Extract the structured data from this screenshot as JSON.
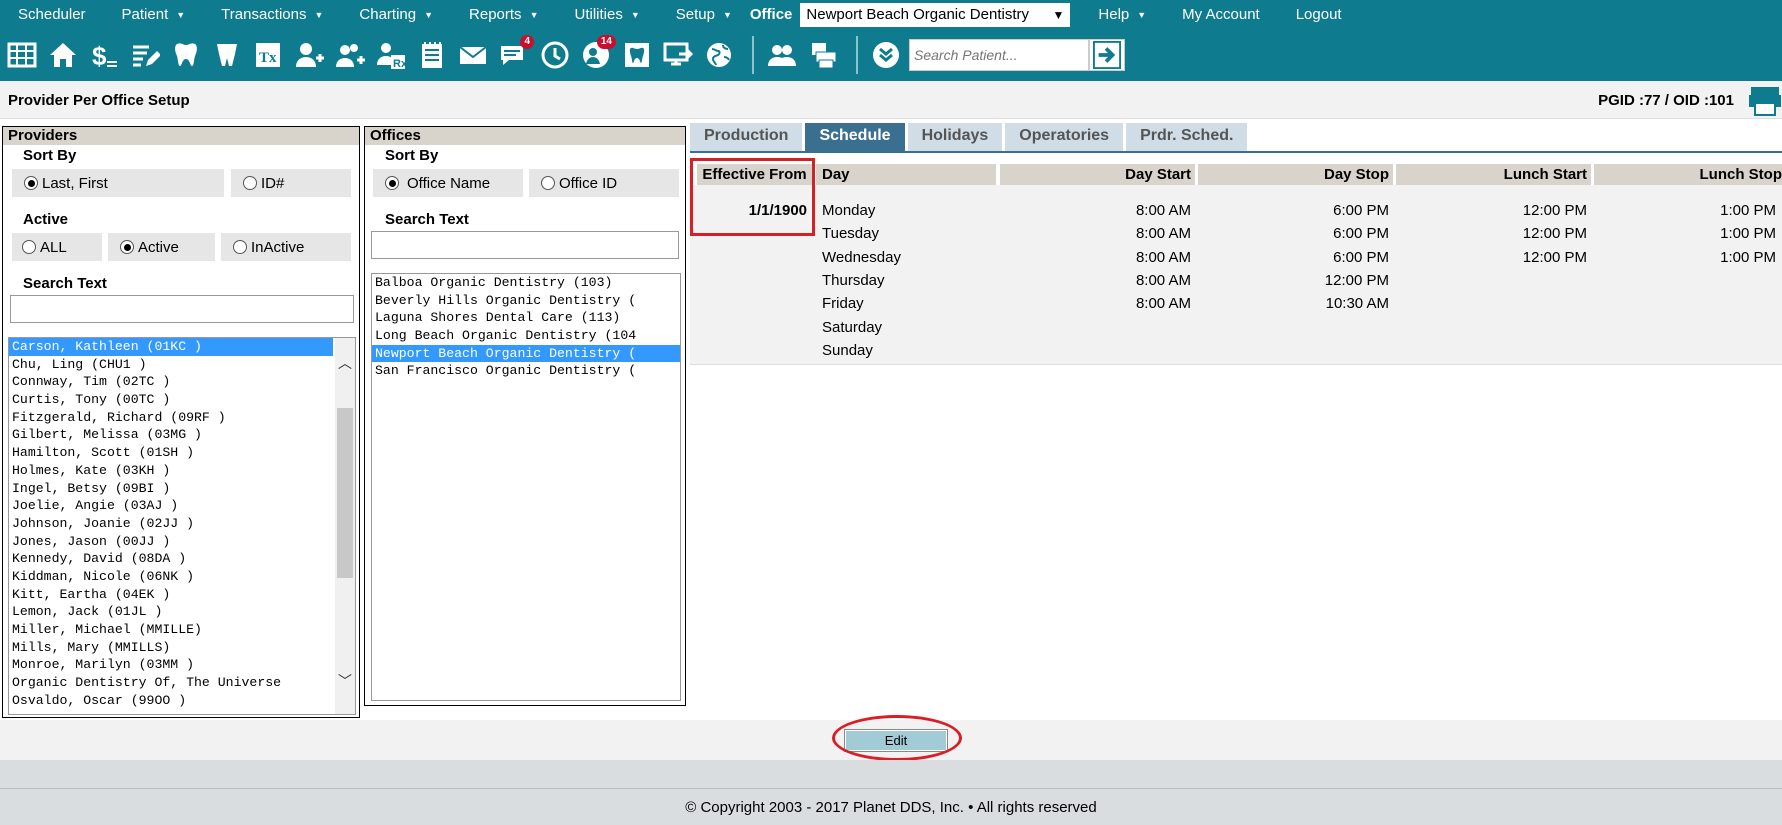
{
  "nav": {
    "items": [
      {
        "label": "Scheduler",
        "caret": false
      },
      {
        "label": "Patient",
        "caret": true
      },
      {
        "label": "Transactions",
        "caret": true
      },
      {
        "label": "Charting",
        "caret": true
      },
      {
        "label": "Reports",
        "caret": true
      },
      {
        "label": "Utilities",
        "caret": true
      },
      {
        "label": "Setup",
        "caret": true
      }
    ],
    "office_label": "Office",
    "office_value": "Newport Beach Organic Dentistry",
    "right_items": [
      {
        "label": "Help",
        "caret": true
      },
      {
        "label": "My Account",
        "caret": false
      },
      {
        "label": "Logout",
        "caret": false
      }
    ]
  },
  "toolbar": {
    "badge_messages": "4",
    "badge_users": "14",
    "search_placeholder": "Search Patient..."
  },
  "header": {
    "title": "Provider Per Office Setup",
    "pgid": "PGID :77  /  OID :101"
  },
  "providers": {
    "heading": "Providers",
    "sort_by_label": "Sort By",
    "sort_options": [
      "Last, First",
      "ID#"
    ],
    "active_label": "Active",
    "active_options": [
      "ALL",
      "Active",
      "InActive"
    ],
    "search_label": "Search Text",
    "list": [
      "Carson, Kathleen (01KC )",
      "Chu, Ling (CHU1 )",
      "Connway, Tim (02TC )",
      "Curtis, Tony (00TC )",
      "Fitzgerald, Richard (09RF )",
      "Gilbert, Melissa (03MG )",
      "Hamilton, Scott (01SH )",
      "Holmes, Kate (03KH )",
      "Ingel, Betsy (09BI )",
      "Joelie, Angie (03AJ )",
      "Johnson, Joanie (02JJ )",
      "Jones, Jason (00JJ )",
      "Kennedy, David (08DA )",
      "Kiddman, Nicole (06NK )",
      "Kitt, Eartha (04EK )",
      "Lemon, Jack (01JL )",
      "Miller, Michael (MMILLE)",
      "Mills, Mary (MMILLS)",
      "Monroe, Marilyn (03MM )",
      "Organic Dentistry Of, The Universe",
      "Osvaldo, Oscar (99OO )"
    ]
  },
  "offices": {
    "heading": "Offices",
    "sort_by_label": "Sort By",
    "sort_options": [
      "Office Name",
      "Office ID"
    ],
    "search_label": "Search Text",
    "list": [
      "Balboa Organic Dentistry (103)",
      "Beverly Hills Organic Dentistry (",
      "Laguna Shores Dental Care (113)",
      "Long Beach Organic Dentistry (104",
      "Newport Beach Organic Dentistry (",
      "San Francisco Organic Dentistry ("
    ]
  },
  "tabs": [
    "Production",
    "Schedule",
    "Holidays",
    "Operatories",
    "Prdr. Sched."
  ],
  "schedule": {
    "columns": [
      "Effective From",
      "Day",
      "Day Start",
      "Day Stop",
      "Lunch Start",
      "Lunch Stop"
    ],
    "effective_from": "1/1/1900",
    "rows": [
      {
        "day": "Monday",
        "start": "8:00 AM",
        "stop": "6:00 PM",
        "lunch_start": "12:00 PM",
        "lunch_stop": "1:00 PM"
      },
      {
        "day": "Tuesday",
        "start": "8:00 AM",
        "stop": "6:00 PM",
        "lunch_start": "12:00 PM",
        "lunch_stop": "1:00 PM"
      },
      {
        "day": "Wednesday",
        "start": "8:00 AM",
        "stop": "6:00 PM",
        "lunch_start": "12:00 PM",
        "lunch_stop": "1:00 PM"
      },
      {
        "day": "Thursday",
        "start": "8:00 AM",
        "stop": "12:00 PM",
        "lunch_start": "",
        "lunch_stop": ""
      },
      {
        "day": "Friday",
        "start": "8:00 AM",
        "stop": "10:30 AM",
        "lunch_start": "",
        "lunch_stop": ""
      },
      {
        "day": "Saturday",
        "start": "",
        "stop": "",
        "lunch_start": "",
        "lunch_stop": ""
      },
      {
        "day": "Sunday",
        "start": "",
        "stop": "",
        "lunch_start": "",
        "lunch_stop": ""
      }
    ]
  },
  "edit_label": "Edit",
  "copyright": "© Copyright 2003 - 2017 Planet DDS, Inc. • All rights reserved",
  "colors": {
    "teal": "#0f7b8e",
    "highlight": "#d71f26",
    "tab_active": "#3b6f8f"
  }
}
